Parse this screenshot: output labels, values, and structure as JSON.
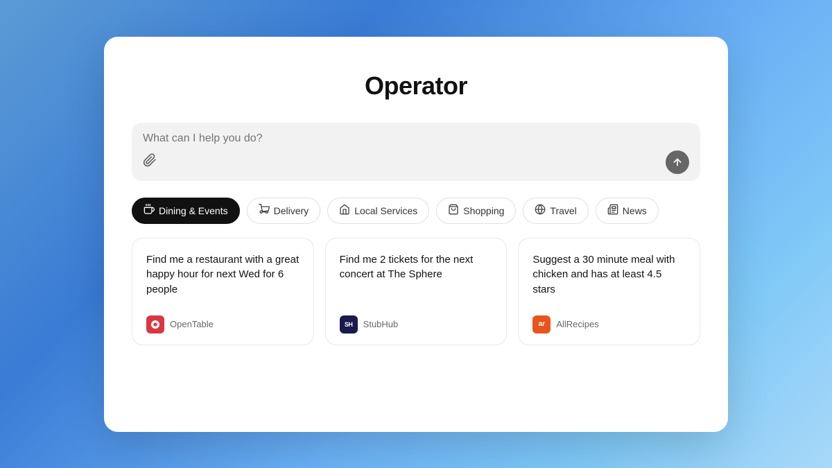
{
  "title": "Operator",
  "search": {
    "placeholder": "What can I help you do?"
  },
  "tabs": [
    {
      "id": "dining",
      "label": "Dining & Events",
      "icon": "🍽",
      "active": true
    },
    {
      "id": "delivery",
      "label": "Delivery",
      "icon": "🛵",
      "active": false
    },
    {
      "id": "local",
      "label": "Local Services",
      "icon": "🏪",
      "active": false
    },
    {
      "id": "shopping",
      "label": "Shopping",
      "icon": "🛍",
      "active": false
    },
    {
      "id": "travel",
      "label": "Travel",
      "icon": "✈",
      "active": false
    },
    {
      "id": "news",
      "label": "News",
      "icon": "📰",
      "active": false
    }
  ],
  "cards": [
    {
      "text": "Find me a restaurant with a great happy hour for next Wed for 6 people",
      "brand_name": "OpenTable",
      "brand_id": "opentable"
    },
    {
      "text": "Find me 2 tickets for the next concert at The Sphere",
      "brand_name": "StubHub",
      "brand_id": "stubhub"
    },
    {
      "text": "Suggest a 30 minute meal with chicken and has at least 4.5 stars",
      "brand_name": "AllRecipes",
      "brand_id": "allrecipes"
    }
  ],
  "icons": {
    "attach": "📎",
    "submit_arrow": "↑"
  }
}
